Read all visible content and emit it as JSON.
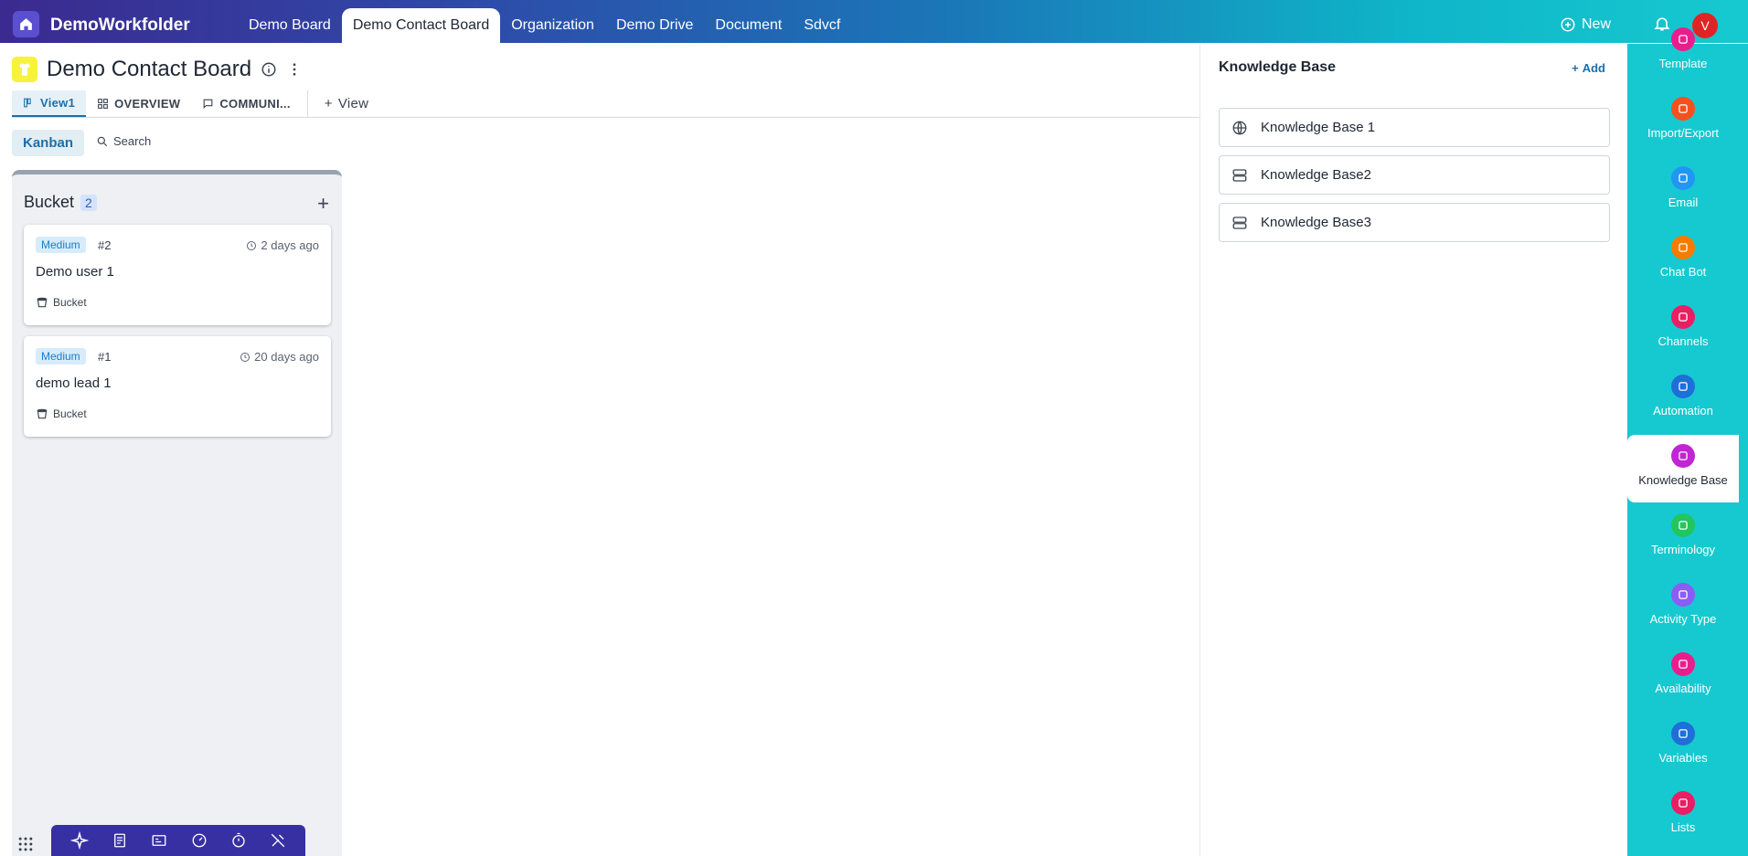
{
  "app": {
    "brand": "DemoWorkfolder",
    "new_label": "New",
    "avatar_initial": "V"
  },
  "tabs": [
    "Demo Board",
    "Demo Contact Board",
    "Organization",
    "Demo Drive",
    "Document",
    "Sdvcf"
  ],
  "active_tab": "Demo Contact Board",
  "board": {
    "title": "Demo Contact Board",
    "views": [
      {
        "label": "View1",
        "icon": "kanban-icon"
      },
      {
        "label": "OVERVIEW",
        "icon": "dashboard-icon"
      },
      {
        "label": "COMMUNI...",
        "icon": "chat-icon"
      }
    ],
    "add_view_label": "View",
    "kanban_label": "Kanban",
    "search_label": "Search"
  },
  "column": {
    "title": "Bucket",
    "count": "2",
    "cards": [
      {
        "priority": "Medium",
        "number": "#2",
        "time": "2 days ago",
        "name": "Demo user 1",
        "bucket": "Bucket"
      },
      {
        "priority": "Medium",
        "number": "#1",
        "time": "20 days ago",
        "name": "demo lead 1",
        "bucket": "Bucket"
      }
    ]
  },
  "knowledge_base": {
    "title": "Knowledge Base",
    "add_label": "Add",
    "items": [
      {
        "label": "Knowledge Base 1",
        "icon": "globe-icon"
      },
      {
        "label": "Knowledge Base2",
        "icon": "database-icon"
      },
      {
        "label": "Knowledge Base3",
        "icon": "database-icon"
      }
    ]
  },
  "right_sidebar": [
    {
      "label": "Template",
      "color": "#e91e8c"
    },
    {
      "label": "Import/Export",
      "color": "#f4511e"
    },
    {
      "label": "Email",
      "color": "#2196f3"
    },
    {
      "label": "Chat Bot",
      "color": "#f57c00"
    },
    {
      "label": "Channels",
      "color": "#e91e63"
    },
    {
      "label": "Automation",
      "color": "#1e6fd9"
    },
    {
      "label": "Knowledge Base",
      "color": "#c026d3"
    },
    {
      "label": "Terminology",
      "color": "#22c55e"
    },
    {
      "label": "Activity Type",
      "color": "#8b5cf6"
    },
    {
      "label": "Availability",
      "color": "#e91e8c"
    },
    {
      "label": "Variables",
      "color": "#1e6fd9"
    },
    {
      "label": "Lists",
      "color": "#e91e63"
    }
  ],
  "active_sidebar": "Knowledge Base"
}
